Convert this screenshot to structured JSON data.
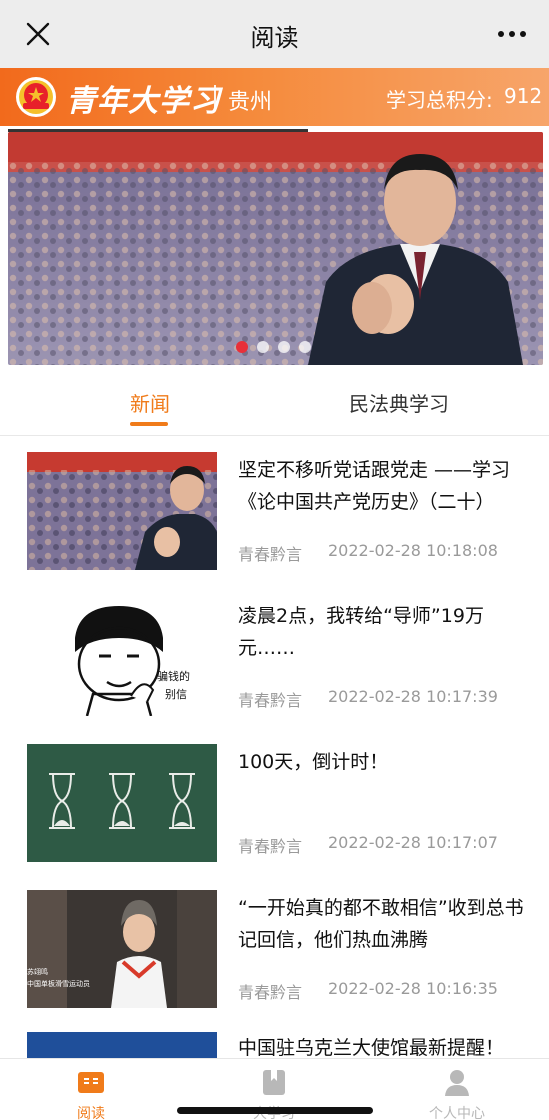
{
  "titlebar": {
    "title": "阅读",
    "close_icon": "close-icon",
    "more_icon": "more-dots-icon"
  },
  "brand": {
    "name": "青年大学习",
    "province": "贵州",
    "score_label": "学习总积分:",
    "score_value": "912",
    "emblem_icon": "league-emblem-icon"
  },
  "banner": {
    "image": "leader-applauding-at-assembly",
    "dot_count": 4,
    "active_dot": 0
  },
  "tabs": [
    {
      "label": "新闻",
      "active": true
    },
    {
      "label": "民法典学习",
      "active": false
    }
  ],
  "articles": [
    {
      "title": "坚定不移听党话跟党走 ——学习《论中国共产党历史》（二十）",
      "source": "青春黔言",
      "time": "2022-02-28 10:18:08",
      "thumb": "leader-applauding"
    },
    {
      "title": "凌晨2点，我转给“导师”19万元……",
      "source": "青春黔言",
      "time": "2022-02-28 10:17:39",
      "thumb": "meme-face",
      "thumb_caption": [
        "骗钱的",
        "别信"
      ]
    },
    {
      "title": "100天，倒计时！",
      "source": "青春黔言",
      "time": "2022-02-28 10:17:07",
      "thumb": "hourglass-chalkboard"
    },
    {
      "title": "“一开始真的都不敢相信”收到总书记回信，他们热血沸腾",
      "source": "青春黔言",
      "time": "2022-02-28 10:16:35",
      "thumb": "athlete-interview",
      "thumb_caption": [
        "苏翊鸣",
        "中国单板滑雪运动员"
      ]
    },
    {
      "title": "中国驻乌克兰大使馆最新提醒！",
      "source": "",
      "time": "",
      "thumb": "blue-banner"
    }
  ],
  "bottom_nav": [
    {
      "label": "阅读",
      "icon": "book-open-icon",
      "active": true
    },
    {
      "label": "大学习",
      "icon": "bookmark-icon",
      "active": false
    },
    {
      "label": "个人中心",
      "icon": "person-icon",
      "active": false
    }
  ],
  "colors": {
    "accent": "#f07b1a",
    "brand_start": "#f26a1c",
    "active_dot": "#e8303a"
  }
}
